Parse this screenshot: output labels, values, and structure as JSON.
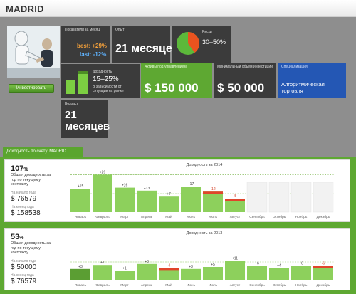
{
  "header": {
    "title": "MADRID"
  },
  "profile": {
    "invest_button": "Инвестировать"
  },
  "tiles": {
    "monthly": {
      "label": "Показатели за месяц",
      "best_label": "best:",
      "best_value": "+29%",
      "last_label": "last:",
      "last_value": "-12%"
    },
    "experience": {
      "label": "Опыт",
      "value": "21 месяцев"
    },
    "risk": {
      "label": "Риски",
      "value": "30–50%",
      "level": 0.4
    },
    "yield": {
      "label": "Доходность",
      "value": "15–25%",
      "note": "В зависимости от ситуации на рынке"
    },
    "assets": {
      "label": "Активы под управлением",
      "value": "$ 150 000"
    },
    "min_invest": {
      "label": "Минимальный объем инвестиций",
      "value": "$ 50 000"
    },
    "specialization": {
      "label": "Специализация",
      "value": "Алгоритмическая торговля"
    },
    "age": {
      "label": "Возраст",
      "value": "21 месяцев"
    }
  },
  "colors": {
    "green": "#5ea832",
    "bar": "#8dd05c",
    "dark_bar": "#5b9e33",
    "red": "#e0452b",
    "blue": "#2457b4",
    "tile": "#3b3b3b"
  },
  "section_tab": "Доходность по счету. MADRID",
  "panels": [
    {
      "percent": "107",
      "percent_sign": "%",
      "total_label": "Общая доходность за год по текущему контракту",
      "start_label": "На начало года",
      "start_value": "$ 76579",
      "end_label": "На конец года",
      "end_value": "$ 158538",
      "chart_data": {
        "type": "bar",
        "title": "Доходность за 2014",
        "categories": [
          "Январь",
          "Февраль",
          "Март",
          "Апрель",
          "Май",
          "Июнь",
          "Июль",
          "Август",
          "Сентябрь",
          "Октябрь",
          "Ноябрь",
          "Декабрь"
        ],
        "values": [
          15,
          29,
          16,
          13,
          7,
          17,
          -12,
          -5,
          null,
          null,
          null,
          null
        ],
        "labels": [
          "+15",
          "+29",
          "+16",
          "+13",
          "+7",
          "+17",
          "-12",
          "-5",
          "",
          "",
          "",
          ""
        ]
      }
    },
    {
      "percent": "53",
      "percent_sign": "%",
      "total_label": "Общая доходность за год по текущему контракту",
      "start_label": "На начало года",
      "start_value": "$ 50000",
      "end_label": "На конец года",
      "end_value": "$ 76579",
      "chart_data": {
        "type": "bar",
        "title": "Доходность за 2013",
        "categories": [
          "Январь",
          "Февраль",
          "Март",
          "Апрель",
          "Май",
          "Июнь",
          "Июль",
          "Август",
          "Сентябрь",
          "Октябрь",
          "Ноябрь",
          "Декабрь"
        ],
        "values": [
          3,
          7,
          1,
          8,
          -4,
          3,
          5,
          11,
          6,
          4,
          6,
          -6
        ],
        "labels": [
          "+3",
          "+7",
          "+1",
          "+8",
          "-4",
          "+3",
          "+5",
          "+11",
          "+6",
          "+4",
          "+6",
          "-6"
        ]
      }
    }
  ]
}
